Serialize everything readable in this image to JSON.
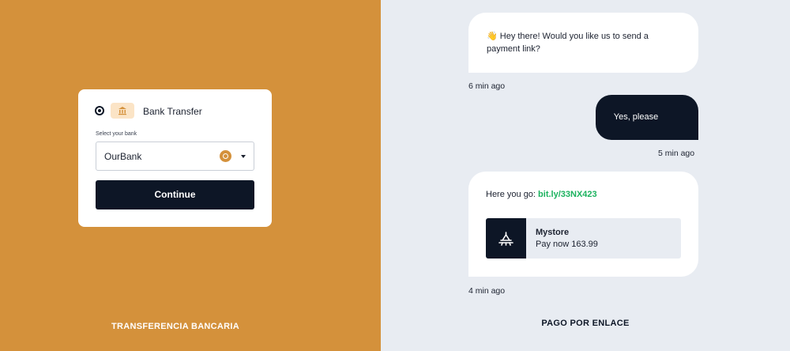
{
  "left_panel": {
    "option_label": "Bank Transfer",
    "field_label": "Select your bank",
    "selected_bank": "OurBank",
    "continue_label": "Continue",
    "caption": "TRANSFERENCIA BANCARIA",
    "background": "#d4913b"
  },
  "right_panel": {
    "messages": [
      {
        "text": "👋 Hey there! Would you like us to send a payment link?",
        "time": "6 min ago"
      },
      {
        "text": "Yes, please",
        "time": "5 min ago"
      },
      {
        "prefix": "Here you go: ",
        "link": "bit.ly/33NX423",
        "time": "4 min ago"
      }
    ],
    "store": {
      "name": "Mystore",
      "pay": "Pay now 163.99"
    },
    "caption": "PAGO POR ENLACE",
    "link_color": "#1bb25e",
    "dark_color": "#0d1626"
  }
}
